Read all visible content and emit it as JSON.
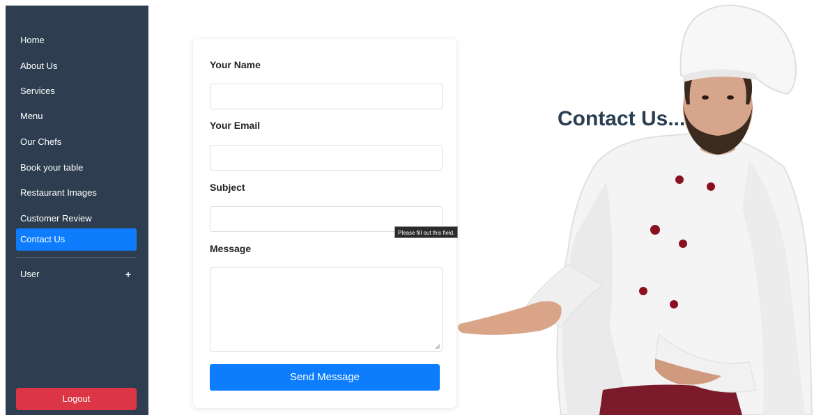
{
  "sidebar": {
    "items": [
      {
        "label": "Home"
      },
      {
        "label": "About Us"
      },
      {
        "label": "Services"
      },
      {
        "label": "Menu"
      },
      {
        "label": "Our Chefs"
      },
      {
        "label": "Book your table"
      },
      {
        "label": "Restaurant Images"
      },
      {
        "label": "Customer Review"
      },
      {
        "label": "Contact Us",
        "active": true
      }
    ],
    "user_label": "User",
    "user_toggle_symbol": "+",
    "logout_label": "Logout"
  },
  "form": {
    "name_label": "Your Name",
    "name_value": "",
    "email_label": "Your Email",
    "email_value": "",
    "subject_label": "Subject",
    "subject_value": "",
    "message_label": "Message",
    "message_value": "",
    "submit_label": "Send Message",
    "validation_tooltip": "Please fill out this field."
  },
  "hero": {
    "title": "Contact Us..."
  },
  "colors": {
    "sidebar_bg": "#2e3e50",
    "accent": "#0d7dfd",
    "logout": "#dc3646",
    "title": "#2a3e52"
  },
  "icons": {
    "user_expand": "plus-icon",
    "textarea_resize": "resize-handle-icon"
  }
}
